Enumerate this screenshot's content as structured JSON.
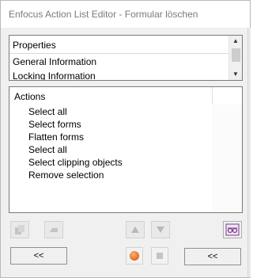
{
  "window": {
    "title": "Enfocus Action List Editor - Formular löschen"
  },
  "properties": {
    "header": "Properties",
    "items": [
      "General Information",
      "Locking Information"
    ]
  },
  "actions": {
    "header": "Actions",
    "items": [
      "Select all",
      "Select forms",
      "Flatten forms",
      "Select all",
      "Select clipping objects",
      "Remove selection"
    ]
  },
  "buttons": {
    "back_left": "<<",
    "back_right": "<<"
  },
  "icons": {
    "add": "add-icon",
    "remove": "remove-icon",
    "up": "move-up-icon",
    "down": "move-down-icon",
    "preview": "glasses-icon",
    "record": "record-icon",
    "stop": "stop-icon"
  },
  "colors": {
    "record": "#e2641c",
    "preview": "#7a3a8c"
  }
}
